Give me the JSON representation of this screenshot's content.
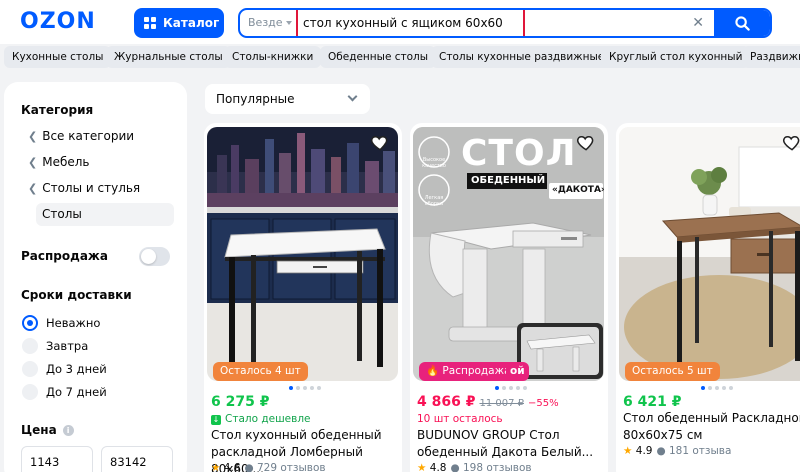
{
  "header": {
    "logo": "OZON",
    "catalog_label": "Каталог",
    "search_scope": "Везде",
    "search_query": "стол кухонный с ящиком 60х60"
  },
  "chips": [
    "Кухонные столы",
    "Журнальные столы",
    "Столы-книжки",
    "Обеденные столы",
    "Столы кухонные раздвижные",
    "Круглый стол кухонный",
    "Раздвижн"
  ],
  "filters": {
    "category_title": "Категория",
    "categories": [
      "Все категории",
      "Мебель",
      "Столы и стулья"
    ],
    "active_category": "Столы",
    "sale_label": "Распродажа",
    "delivery_title": "Сроки доставки",
    "delivery_options": [
      "Неважно",
      "Завтра",
      "До 3 дней",
      "До 7 дней"
    ],
    "delivery_selected": "Неважно",
    "price_title": "Цена",
    "price_info": "i",
    "price_min": "1143",
    "price_max": "83142"
  },
  "sort": {
    "label": "Популярные"
  },
  "products": [
    {
      "badge": "Осталось 4 шт",
      "price": "6 275 ₽",
      "sub": "Стало дешевле",
      "title": "Стол кухонный обеденный раскладной Ломберный 80х60 ...",
      "rating": "4.6",
      "reviews": "729 отзывов"
    },
    {
      "badge": "Распродажа",
      "badge_tail": "ой",
      "promo_title": "СТОЛ",
      "promo_sub": "ОБЕДЕННЫЙ",
      "promo_name": "«ДАКОТА»",
      "promo_icons": [
        "Высокое качество",
        "Легкая сборка"
      ],
      "price": "4 866 ₽",
      "old_price": "11 007 ₽",
      "discount": "−55%",
      "sub": "10 шт осталось",
      "title": "BUDUNOV GROUP Стол обеденный Дакота Белый...",
      "rating": "4.8",
      "reviews": "198 отзывов"
    },
    {
      "badge": "Осталось 5 шт",
      "price": "6 421 ₽",
      "title": "Стол обеденный Раскладной, 80х60х75 см",
      "rating": "4.9",
      "reviews": "181 отзыва"
    }
  ],
  "colors": {
    "brand_blue": "#005bff",
    "price_green": "#10c44c",
    "price_pink": "#f91155",
    "badge_orange": "#f1843c",
    "badge_pink": "#e8227c",
    "search_highlight": "#e0163a"
  }
}
